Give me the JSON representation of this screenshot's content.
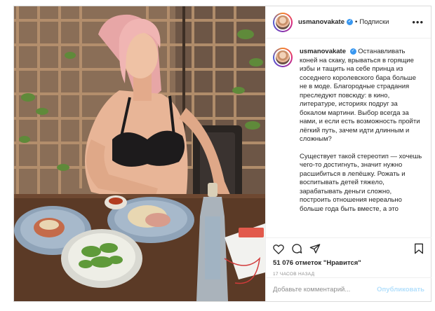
{
  "post": {
    "username": "usmanovakate",
    "verified_mark": "✓",
    "separator": "•",
    "follow_label": "Подписки",
    "more_label": "•••",
    "caption_paragraphs": [
      "Останавливать коней на скаку, врываться в горящие избы и тащить на себе принца из соседнего королевского бара больше не в моде. Благородные страдания преследуют повсюду: в кино, литературе, историях подруг за бокалом мартини. Выбор всегда за нами, и если есть возможность пройти лёгкий путь, зачем идти длинным и сложным?",
      "Существует такой стереотип — хочешь чего-то достигнуть, значит нужно расшибиться в лепёшку. Рожать и воспитывать детей тяжело, зарабатывать деньги сложно, построить отношения нереально больше года быть вместе, а это"
    ],
    "likes_text": "51 076 отметок \"Нравится\"",
    "time_ago": "17 ЧАСОВ НАЗАД",
    "comment_placeholder": "Добавьте комментарий...",
    "publish_label": "Опубликовать",
    "icons": {
      "like": "heart-icon",
      "comment": "comment-icon",
      "share": "share-icon",
      "save": "bookmark-icon"
    },
    "colors": {
      "link_disabled": "#b2dffc",
      "verified": "#3897f0",
      "muted": "#8e8e8e"
    }
  }
}
